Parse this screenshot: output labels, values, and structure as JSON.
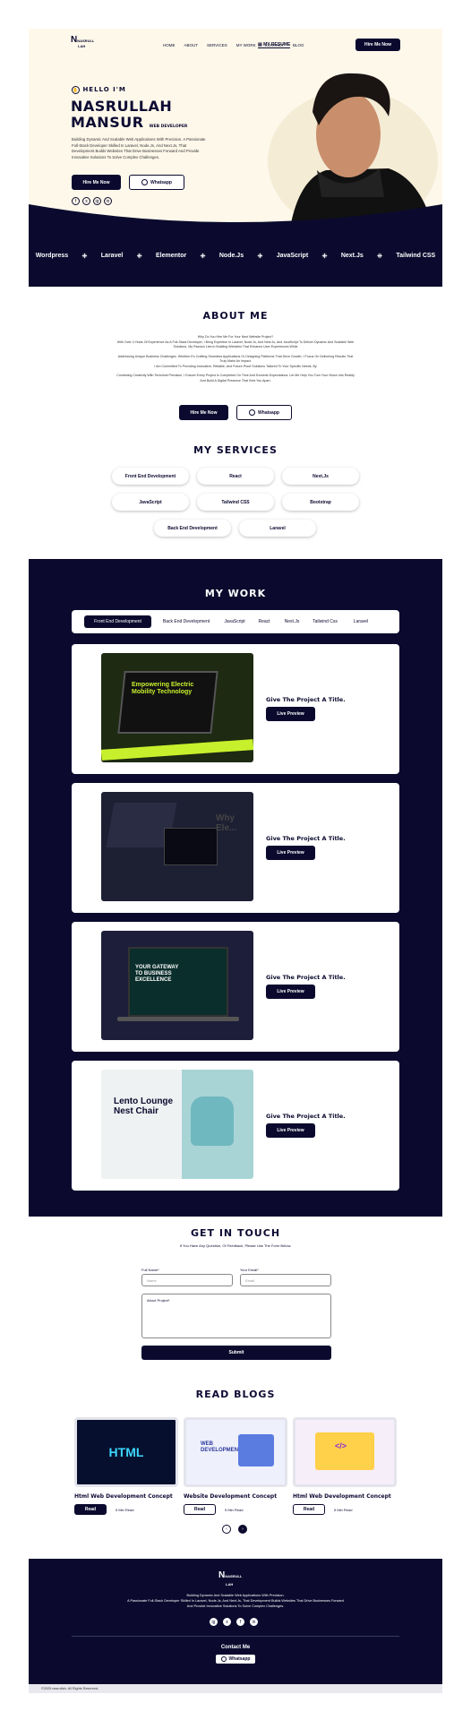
{
  "brand": {
    "logo_l1": "NASRULL",
    "logo_l2": "LAH",
    "big_n": "N"
  },
  "nav": {
    "items": [
      "HOME",
      "ABOUT",
      "SERVICES",
      "MY WORK",
      "CONTACT",
      "BLOG"
    ],
    "resume": "MY RESUME",
    "hire": "Hire Me Now"
  },
  "hero": {
    "hello": "HELLO I'M",
    "name1": "NASRULLAH",
    "name2": "MANSUR",
    "role": "WEB DEVELOPER",
    "desc": "Building Dynamic And Scalable Web Applications With Precision. A Passionate Full-Stack Developer Skilled In Laravel, Node.Js, And Next.Js, That Development Builds Websites That Drive Businesses Forward And Provide Innovative Solutions To Solve Complex Challenges.",
    "hire": "Hire Me Now",
    "whatsapp": "Whatsapp",
    "socials": [
      "f",
      "x",
      "ig",
      "in"
    ]
  },
  "tech": [
    "Wordpress",
    "Laravel",
    "Elementor",
    "Node.Js",
    "JavaScript",
    "Next.Js",
    "Tailwind CSS"
  ],
  "about": {
    "title": "ABOUT ME",
    "p1": "Why Do You Hire Me For Your Next Website Project?",
    "p2": "With Over 4 Years Of Experience As A Full-Stack Developer, I Bring Expertise In Laravel, Node.Js, And Next.Js, And JavaScript To Deliver Dynamic And Scalable Web Solutions. My Passion Lies In Building Websites That Enhance User Experiences While",
    "p3": "Addressing Unique Business Challenges. Whether It's Crafting Seamless Applications Or Designing Platforms That Drive Growth, I Focus On Delivering Results That Truly Make An Impact.",
    "p4": "I Am Committed To Providing Innovative, Reliable, And Future-Proof Solutions Tailored To Your Specific Needs. By",
    "p5": "Combining Creativity With Technical Precision, I Ensure Every Project Is Completed On Time And Exceeds Expectations. Let Me Help You Turn Your Vision Into Reality And Build A Digital Presence That Sets You Apart.",
    "hire": "Hire Me Now",
    "whatsapp": "Whatsapp"
  },
  "services": {
    "title": "MY SERVICES",
    "items": [
      "Front End Development",
      "React",
      "Next.Js",
      "JavaScript",
      "Tailwind CSS",
      "Bootstrap",
      "Back End Development",
      "Laravel"
    ]
  },
  "work": {
    "title": "MY WORK",
    "tabs": [
      "Front End Development",
      "Back End Development",
      "JavaScript",
      "React",
      "Next.Js",
      "Tailwind Css",
      "Laravel"
    ],
    "cards": [
      {
        "title": "Give The Project A Title.",
        "button": "Live Preview",
        "img": "Empowering Electric Mobility Technology"
      },
      {
        "title": "Give The Project A Title.",
        "button": "Live Preview",
        "img": "Why Ele..."
      },
      {
        "title": "Give The Project A Title.",
        "button": "Live Preview",
        "img": "YOUR GATEWAY TO BUSINESS EXCELLENCE"
      },
      {
        "title": "Give The Project A Title.",
        "button": "Live Preview",
        "img": "Lento Lounge Nest Chair"
      }
    ]
  },
  "contact": {
    "title": "GET IN TOUCH",
    "subtitle": "If You Have Any Question, Of Feedback, Please Use The Form Below.",
    "name_label": "Full Name*",
    "name_ph": "Name",
    "email_label": "Your Email*",
    "email_ph": "Email",
    "about_label": "About Project*",
    "submit": "Submit"
  },
  "blogs": {
    "title": "READ BLOGS",
    "items": [
      {
        "title": "Html Web Development Concept",
        "read": "Read",
        "time": "5 Min Read",
        "img": "HTML"
      },
      {
        "title": "Website Development Concept",
        "read": "Read",
        "time": "5 Min Read",
        "img": "WEB DEVELOPMENT"
      },
      {
        "title": "Html Web Development Concept",
        "read": "Read",
        "time": "5 Min Read",
        "img": "</>"
      }
    ]
  },
  "footer": {
    "desc1": "Building Dynamic And Scalable Web Applications With Precision.",
    "desc2": "A Passionate Full-Stack Developer Skilled In Laravel, Node.Js, And Next.Js, That Development Builds Websites That Drive Businesses Forward",
    "desc3": "And Provide Innovative Solutions To Solve Complex Challenges.",
    "contact_title": "Contact Me",
    "whatsapp": "Whatsapp",
    "copyright": "©2025 nasrullah. All Rights Reserved.",
    "socials": [
      "ig",
      "x",
      "f",
      "in"
    ]
  },
  "colors": {
    "navy": "#0b0a2e",
    "cream": "#fdf8ea"
  }
}
